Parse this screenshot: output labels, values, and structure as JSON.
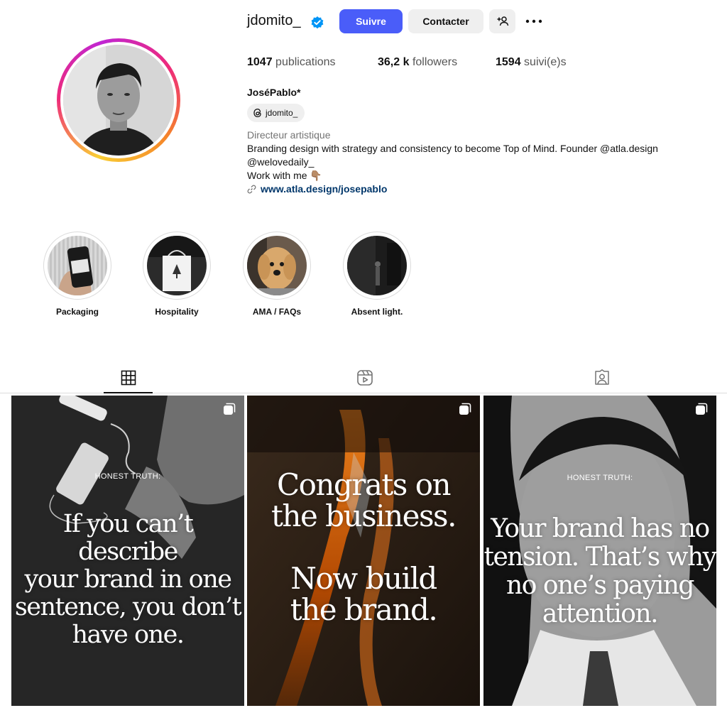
{
  "profile": {
    "username": "jdomito_",
    "display_name": "JoséPablo*",
    "threads_handle": "jdomito_",
    "category": "Directeur artistique",
    "bio_line1": "Branding design with strategy and consistency to become Top of Mind. Founder @atla.design",
    "bio_line2": "@welovedaily_",
    "bio_line3": "Work with me 👇🏽",
    "link": "www.atla.design/josepablo"
  },
  "actions": {
    "follow": "Suivre",
    "contact": "Contacter"
  },
  "stats": {
    "posts_count": "1047",
    "posts_label": "publications",
    "followers_count": "36,2 k",
    "followers_label": "followers",
    "following_count": "1594",
    "following_label": "suivi(e)s"
  },
  "highlights": [
    {
      "label": "Packaging"
    },
    {
      "label": "Hospitality"
    },
    {
      "label": "AMA / FAQs"
    },
    {
      "label": "Absent light."
    }
  ],
  "tabs": [
    {
      "icon": "grid-icon",
      "active": true
    },
    {
      "icon": "reels-icon",
      "active": false
    },
    {
      "icon": "tagged-icon",
      "active": false
    }
  ],
  "posts": [
    {
      "kicker": "HONEST TRUTH:",
      "text": "If you can’t describe\nyour brand in one\nsentence, you don’t\nhave one."
    },
    {
      "kicker": "",
      "text": "Congrats on\nthe business.\n\nNow build\nthe brand."
    },
    {
      "kicker": "HONEST TRUTH:",
      "text": "Your brand has no\ntension. That’s why\nno one’s paying\nattention."
    }
  ],
  "colors": {
    "follow_button": "#4a5df9",
    "secondary_button": "#efefef",
    "link": "#00376b",
    "verified": "#0095f6"
  }
}
